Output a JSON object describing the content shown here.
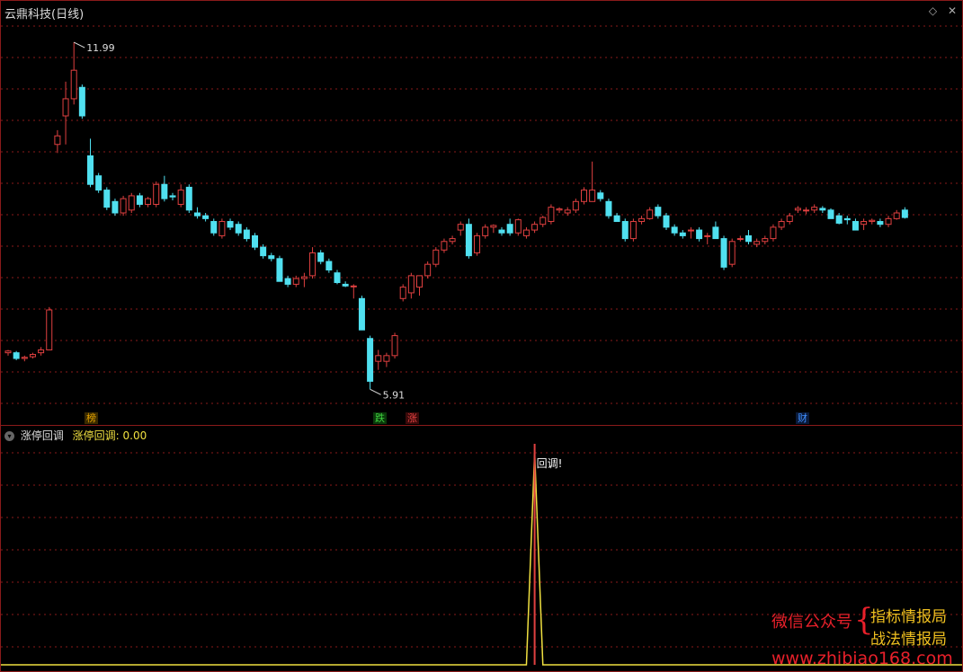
{
  "main": {
    "title": "云鼎科技(日线)",
    "icons": [
      "diamond-icon",
      "close-icon"
    ],
    "high_label": "11.99",
    "low_label": "5.91",
    "tags": [
      {
        "text": "榜",
        "color": "#e0a000"
      },
      {
        "text": "跌",
        "color": "#40d040"
      },
      {
        "text": "涨",
        "color": "#e04040"
      },
      {
        "text": "财",
        "color": "#4090ff"
      }
    ]
  },
  "indicator": {
    "name": "涨停回调",
    "label": "涨停回调: 0.00",
    "annotation": "回调!"
  },
  "watermark": {
    "line1": "微信公众号",
    "line2": "指标情报局",
    "line3": "战法情报局",
    "url": "www.zhibiao168.com"
  },
  "colors": {
    "up": "#e04040",
    "down": "#50e0f0",
    "grid": "#8a1a1a",
    "signal": "#f0e040",
    "background": "#000000"
  },
  "chart_data": {
    "type": "candlestick",
    "ohlc": [
      [
        6.55,
        6.6,
        6.5,
        6.58
      ],
      [
        6.55,
        6.58,
        6.42,
        6.45
      ],
      [
        6.45,
        6.5,
        6.4,
        6.47
      ],
      [
        6.48,
        6.55,
        6.45,
        6.52
      ],
      [
        6.55,
        6.65,
        6.5,
        6.6
      ],
      [
        6.6,
        7.35,
        6.6,
        7.3
      ],
      [
        10.2,
        10.45,
        10.05,
        10.35
      ],
      [
        10.7,
        11.3,
        10.2,
        11.0
      ],
      [
        11.0,
        11.99,
        10.9,
        11.5
      ],
      [
        11.2,
        11.25,
        10.65,
        10.7
      ],
      [
        10.0,
        10.3,
        9.45,
        9.5
      ],
      [
        9.65,
        9.7,
        9.35,
        9.4
      ],
      [
        9.4,
        9.45,
        9.05,
        9.1
      ],
      [
        9.2,
        9.25,
        8.95,
        9.0
      ],
      [
        9.0,
        9.3,
        8.95,
        9.25
      ],
      [
        9.05,
        9.35,
        9.0,
        9.3
      ],
      [
        9.3,
        9.35,
        9.1,
        9.15
      ],
      [
        9.15,
        9.28,
        9.1,
        9.25
      ],
      [
        9.15,
        9.55,
        9.1,
        9.5
      ],
      [
        9.5,
        9.65,
        9.2,
        9.25
      ],
      [
        9.3,
        9.35,
        9.22,
        9.28
      ],
      [
        9.15,
        9.5,
        9.1,
        9.4
      ],
      [
        9.45,
        9.5,
        9.0,
        9.05
      ],
      [
        9.0,
        9.1,
        8.9,
        8.95
      ],
      [
        8.95,
        9.0,
        8.85,
        8.9
      ],
      [
        8.85,
        8.9,
        8.6,
        8.65
      ],
      [
        8.6,
        8.9,
        8.55,
        8.85
      ],
      [
        8.85,
        8.9,
        8.7,
        8.75
      ],
      [
        8.8,
        8.85,
        8.6,
        8.65
      ],
      [
        8.7,
        8.75,
        8.5,
        8.55
      ],
      [
        8.6,
        8.65,
        8.35,
        8.4
      ],
      [
        8.4,
        8.45,
        8.2,
        8.25
      ],
      [
        8.25,
        8.3,
        8.15,
        8.2
      ],
      [
        8.2,
        8.25,
        7.8,
        7.8
      ],
      [
        7.85,
        7.9,
        7.7,
        7.75
      ],
      [
        7.75,
        7.9,
        7.7,
        7.85
      ],
      [
        7.85,
        7.95,
        7.7,
        7.88
      ],
      [
        7.9,
        8.4,
        7.85,
        8.3
      ],
      [
        8.3,
        8.35,
        8.1,
        8.15
      ],
      [
        8.15,
        8.2,
        7.95,
        8.0
      ],
      [
        7.95,
        8.0,
        7.75,
        7.78
      ],
      [
        7.75,
        7.8,
        7.7,
        7.72
      ],
      [
        7.72,
        7.75,
        7.5,
        7.72
      ],
      [
        7.5,
        7.55,
        6.95,
        6.95
      ],
      [
        6.8,
        6.85,
        5.91,
        6.05
      ],
      [
        6.4,
        6.6,
        6.25,
        6.5
      ],
      [
        6.4,
        6.55,
        6.3,
        6.5
      ],
      [
        6.5,
        6.9,
        6.45,
        6.85
      ],
      [
        7.5,
        7.75,
        7.45,
        7.7
      ],
      [
        7.6,
        7.95,
        7.5,
        7.9
      ],
      [
        7.7,
        7.9,
        7.55,
        7.9
      ],
      [
        7.9,
        8.15,
        7.85,
        8.1
      ],
      [
        8.1,
        8.4,
        8.05,
        8.35
      ],
      [
        8.35,
        8.55,
        8.3,
        8.5
      ],
      [
        8.5,
        8.6,
        8.45,
        8.55
      ],
      [
        8.7,
        8.85,
        8.6,
        8.8
      ],
      [
        8.8,
        8.9,
        8.2,
        8.25
      ],
      [
        8.3,
        8.65,
        8.25,
        8.6
      ],
      [
        8.6,
        8.8,
        8.55,
        8.75
      ],
      [
        8.75,
        8.8,
        8.65,
        8.78
      ],
      [
        8.7,
        8.75,
        8.6,
        8.65
      ],
      [
        8.8,
        8.9,
        8.6,
        8.65
      ],
      [
        8.65,
        8.9,
        8.6,
        8.88
      ],
      [
        8.6,
        8.75,
        8.55,
        8.7
      ],
      [
        8.7,
        8.85,
        8.65,
        8.8
      ],
      [
        8.8,
        8.95,
        8.75,
        8.92
      ],
      [
        8.85,
        9.15,
        8.8,
        9.1
      ],
      [
        9.05,
        9.1,
        9.0,
        9.07
      ],
      [
        9.0,
        9.1,
        8.95,
        9.05
      ],
      [
        9.05,
        9.25,
        9.0,
        9.2
      ],
      [
        9.2,
        9.45,
        9.15,
        9.4
      ],
      [
        9.2,
        9.9,
        9.2,
        9.4
      ],
      [
        9.35,
        9.4,
        9.2,
        9.25
      ],
      [
        9.2,
        9.25,
        8.9,
        8.95
      ],
      [
        8.95,
        9.0,
        8.85,
        8.85
      ],
      [
        8.85,
        8.9,
        8.5,
        8.55
      ],
      [
        8.55,
        8.9,
        8.5,
        8.85
      ],
      [
        8.85,
        8.95,
        8.8,
        8.9
      ],
      [
        8.9,
        9.1,
        8.88,
        9.05
      ],
      [
        9.1,
        9.15,
        8.9,
        8.95
      ],
      [
        8.95,
        9.0,
        8.7,
        8.75
      ],
      [
        8.75,
        8.8,
        8.6,
        8.65
      ],
      [
        8.65,
        8.7,
        8.55,
        8.6
      ],
      [
        8.7,
        8.75,
        8.55,
        8.7
      ],
      [
        8.7,
        8.75,
        8.5,
        8.55
      ],
      [
        8.6,
        8.65,
        8.45,
        8.6
      ],
      [
        8.75,
        8.85,
        8.55,
        8.55
      ],
      [
        8.55,
        8.6,
        8.0,
        8.05
      ],
      [
        8.1,
        8.55,
        8.05,
        8.5
      ],
      [
        8.55,
        8.6,
        8.5,
        8.55
      ],
      [
        8.6,
        8.7,
        8.45,
        8.5
      ],
      [
        8.45,
        8.55,
        8.4,
        8.5
      ],
      [
        8.5,
        8.6,
        8.45,
        8.55
      ],
      [
        8.55,
        8.8,
        8.5,
        8.75
      ],
      [
        8.75,
        8.9,
        8.7,
        8.85
      ],
      [
        8.85,
        9.0,
        8.8,
        8.95
      ],
      [
        9.05,
        9.12,
        9.0,
        9.08
      ],
      [
        9.05,
        9.1,
        8.98,
        9.05
      ],
      [
        9.05,
        9.15,
        9.0,
        9.1
      ],
      [
        9.08,
        9.12,
        9.0,
        9.05
      ],
      [
        9.05,
        9.08,
        8.9,
        8.9
      ],
      [
        8.95,
        9.0,
        8.8,
        8.82
      ],
      [
        8.9,
        8.95,
        8.8,
        8.88
      ],
      [
        8.85,
        8.9,
        8.7,
        8.7
      ],
      [
        8.8,
        8.9,
        8.7,
        8.85
      ],
      [
        8.85,
        8.9,
        8.8,
        8.87
      ],
      [
        8.85,
        8.9,
        8.75,
        8.8
      ],
      [
        8.8,
        8.95,
        8.75,
        8.9
      ],
      [
        8.9,
        9.05,
        8.88,
        9.0
      ],
      [
        9.05,
        9.1,
        8.9,
        8.92
      ]
    ],
    "signal": [
      0,
      0,
      0,
      0,
      0,
      0,
      0,
      0,
      0,
      0,
      0,
      0,
      0,
      0,
      0,
      0,
      0,
      0,
      0,
      0,
      0,
      0,
      0,
      0,
      0,
      0,
      0,
      0,
      0,
      0,
      0,
      0,
      0,
      0,
      0,
      0,
      0,
      0,
      0,
      0,
      0,
      0,
      0,
      0,
      0,
      0,
      0,
      0,
      0,
      0,
      0,
      0,
      0,
      0,
      0,
      0,
      0,
      0,
      0,
      0,
      0,
      0,
      0,
      0,
      1,
      0,
      0,
      0,
      0,
      0,
      0,
      0,
      0,
      0,
      0,
      0,
      0,
      0,
      0,
      0,
      0,
      0,
      0,
      0,
      0,
      0,
      0,
      0,
      0,
      0,
      0,
      0,
      0,
      0,
      0,
      0,
      0,
      0,
      0,
      0,
      0,
      0,
      0,
      0,
      0,
      0,
      0,
      0,
      0,
      0,
      0,
      0,
      0,
      0,
      0
    ],
    "ylim": [
      5.6,
      12.4
    ]
  }
}
